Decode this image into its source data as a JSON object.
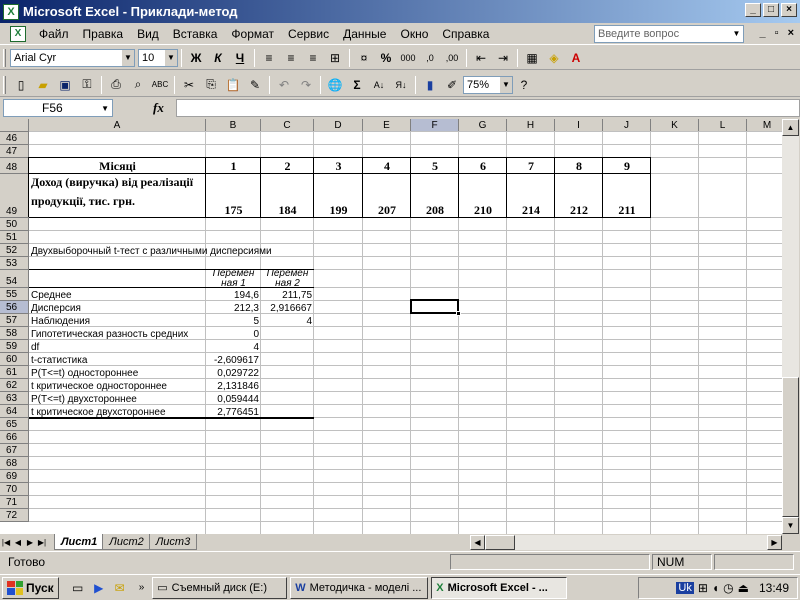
{
  "window": {
    "title": "Microsoft Excel - Приклади-метод",
    "minimize": "_",
    "maximize": "□",
    "close": "×"
  },
  "menu": {
    "items": [
      "Файл",
      "Правка",
      "Вид",
      "Вставка",
      "Формат",
      "Сервис",
      "Данные",
      "Окно",
      "Справка"
    ],
    "help_placeholder": "Введите вопрос",
    "mdi_min": "_",
    "mdi_restore": "▫",
    "mdi_close": "×"
  },
  "toolbar1": {
    "font": "Arial Cyr",
    "size": "10",
    "bold": "Ж",
    "italic": "К",
    "underline": "Ч",
    "percent": "%",
    "thousands": "000"
  },
  "toolbar2": {
    "zoom": "75%",
    "sum": "Σ"
  },
  "formula_bar": {
    "name_box": "F56",
    "fx": "fx",
    "content": ""
  },
  "columns": [
    "A",
    "B",
    "C",
    "D",
    "E",
    "F",
    "G",
    "H",
    "I",
    "J",
    "K",
    "L",
    "M"
  ],
  "rows": [
    "46",
    "47",
    "48",
    "49",
    "50",
    "51",
    "52",
    "53",
    "54",
    "55",
    "56",
    "57",
    "58",
    "59",
    "60",
    "61",
    "62",
    "63",
    "64",
    "65",
    "66",
    "67",
    "68",
    "69",
    "70",
    "71",
    "72"
  ],
  "table": {
    "header_label": "Місяці",
    "months": [
      "1",
      "2",
      "3",
      "4",
      "5",
      "6",
      "7",
      "8",
      "9"
    ],
    "income_label_1": "Доход (виручка) від реалізації",
    "income_label_2": "продукції, тис. грн.",
    "income": [
      "175",
      "184",
      "199",
      "207",
      "208",
      "210",
      "214",
      "212",
      "211"
    ]
  },
  "ttest": {
    "title": "Двухвыборочный t-тест с различными дисперсиями",
    "var1_line1": "Перемен",
    "var1_line2": "ная 1",
    "var2_line1": "Перемен",
    "var2_line2": "ная 2",
    "rows": [
      {
        "label": "Среднее",
        "v1": "194,6",
        "v2": "211,75"
      },
      {
        "label": "Дисперсия",
        "v1": "212,3",
        "v2": "2,916667"
      },
      {
        "label": "Наблюдения",
        "v1": "5",
        "v2": "4"
      },
      {
        "label": "Гипотетическая разность средних",
        "v1": "0",
        "v2": ""
      },
      {
        "label": "df",
        "v1": "4",
        "v2": ""
      },
      {
        "label": "t-статистика",
        "v1": "-2,609617",
        "v2": ""
      },
      {
        "label": "P(T<=t) одностороннее",
        "v1": "0,029722",
        "v2": ""
      },
      {
        "label": "t критическое одностороннее",
        "v1": "2,131846",
        "v2": ""
      },
      {
        "label": "P(T<=t) двухстороннее",
        "v1": "0,059444",
        "v2": ""
      },
      {
        "label": "t критическое двухстороннее",
        "v1": "2,776451",
        "v2": ""
      }
    ]
  },
  "sheets": {
    "tabs": [
      "Лист1",
      "Лист2",
      "Лист3"
    ],
    "active": "Лист1"
  },
  "status": {
    "ready": "Готово",
    "num": "NUM"
  },
  "taskbar": {
    "start": "Пуск",
    "tasks": [
      "Съемный диск (E:)",
      "Методичка - моделі ...",
      "Microsoft Excel - ..."
    ],
    "lang": "Uk",
    "clock": "13:49"
  }
}
